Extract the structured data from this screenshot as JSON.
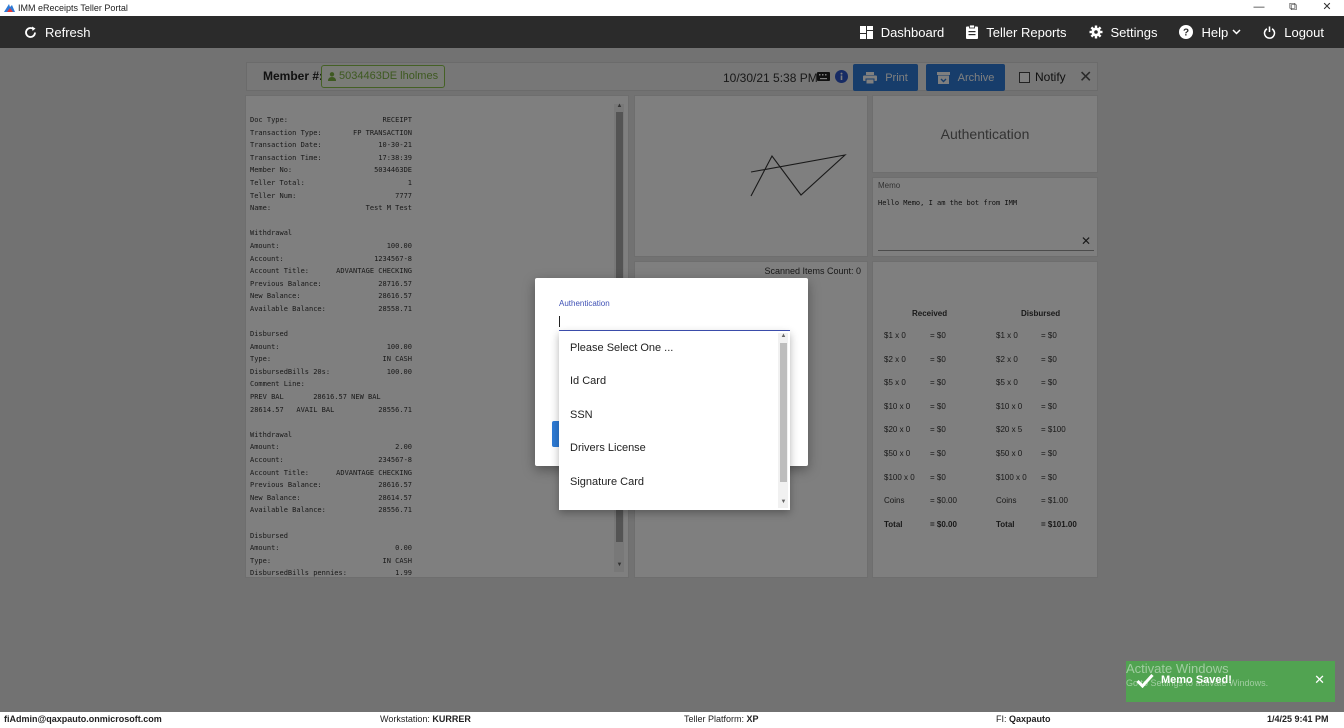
{
  "window": {
    "title": "IMM eReceipts Teller Portal",
    "controls": [
      "—",
      "⧉",
      "✕"
    ]
  },
  "nav": {
    "refresh": "Refresh",
    "dashboard": "Dashboard",
    "teller_reports": "Teller Reports",
    "settings": "Settings",
    "help": "Help",
    "logout": "Logout"
  },
  "member_bar": {
    "label": "Member #:",
    "member": "5034463DE lholmes",
    "datetime": "10/30/21 5:38 PM",
    "print": "Print",
    "archive": "Archive",
    "notify": "Notify",
    "close": "✕"
  },
  "receipt": {
    "lines": [
      [
        "Doc Type:",
        "RECEIPT"
      ],
      [
        "Transaction Type:",
        "FP TRANSACTION"
      ],
      [
        "Transaction Date:",
        "10-30-21"
      ],
      [
        "Transaction Time:",
        "17:38:39"
      ],
      [
        "Member No:",
        "5034463DE"
      ],
      [
        "Teller Total:",
        "1"
      ],
      [
        "Teller Num:",
        "7777"
      ],
      [
        "Name:",
        "Test M Test"
      ],
      [
        "",
        ""
      ],
      [
        "Withdrawal",
        ""
      ],
      [
        "Amount:",
        "100.00"
      ],
      [
        "Account:",
        "1234567-8"
      ],
      [
        "Account Title:",
        "ADVANTAGE CHECKING"
      ],
      [
        "Previous Balance:",
        "28716.57"
      ],
      [
        "New Balance:",
        "28616.57"
      ],
      [
        "Available Balance:",
        "28558.71"
      ],
      [
        "",
        ""
      ],
      [
        "Disbursed",
        ""
      ],
      [
        "Amount:",
        "100.00"
      ],
      [
        "Type:",
        "IN CASH"
      ],
      [
        "DisbursedBills 20s:",
        "100.00"
      ],
      [
        "Comment Line:",
        ""
      ],
      [
        "PREV BAL       28616.57 NEW BAL",
        ""
      ],
      [
        "28614.57   AVAIL BAL",
        "28556.71"
      ],
      [
        "",
        ""
      ],
      [
        "Withdrawal",
        ""
      ],
      [
        "Amount:",
        "2.00"
      ],
      [
        "Account:",
        "234567-8"
      ],
      [
        "Account Title:",
        "ADVANTAGE CHECKING"
      ],
      [
        "Previous Balance:",
        "28616.57"
      ],
      [
        "New Balance:",
        "28614.57"
      ],
      [
        "Available Balance:",
        "28556.71"
      ],
      [
        "",
        ""
      ],
      [
        "Disbursed",
        ""
      ],
      [
        "Amount:",
        "0.00"
      ],
      [
        "Type:",
        "IN CASH"
      ],
      [
        "DisbursedBills pennies:",
        "1.99"
      ]
    ]
  },
  "scanned_items": "Scanned Items Count: 0",
  "auth_panel_title": "Authentication",
  "memo": {
    "label": "Memo",
    "text": "Hello Memo, I am the bot from IMM",
    "clear": "✕"
  },
  "cash": {
    "received_header": "Received",
    "disbursed_header": "Disbursed",
    "rows": [
      {
        "r_denom": "$1 x 0",
        "r_amt": "= $0",
        "d_denom": "$1 x 0",
        "d_amt": "= $0"
      },
      {
        "r_denom": "$2 x 0",
        "r_amt": "= $0",
        "d_denom": "$2 x 0",
        "d_amt": "= $0"
      },
      {
        "r_denom": "$5 x 0",
        "r_amt": "= $0",
        "d_denom": "$5 x 0",
        "d_amt": "= $0"
      },
      {
        "r_denom": "$10 x 0",
        "r_amt": "= $0",
        "d_denom": "$10 x 0",
        "d_amt": "= $0"
      },
      {
        "r_denom": "$20 x 0",
        "r_amt": "= $0",
        "d_denom": "$20 x 5",
        "d_amt": "= $100"
      },
      {
        "r_denom": "$50 x 0",
        "r_amt": "= $0",
        "d_denom": "$50 x 0",
        "d_amt": "= $0"
      },
      {
        "r_denom": "$100 x 0",
        "r_amt": "= $0",
        "d_denom": "$100 x 0",
        "d_amt": "= $0"
      },
      {
        "r_denom": "Coins",
        "r_amt": "= $0.00",
        "d_denom": "Coins",
        "d_amt": "= $1.00"
      },
      {
        "r_denom": "Total",
        "r_amt": "= $0.00",
        "d_denom": "Total",
        "d_amt": "= $101.00"
      }
    ]
  },
  "dialog": {
    "label": "Authentication",
    "value": "",
    "options": [
      "Please Select One ...",
      "Id Card",
      "SSN",
      "Drivers License",
      "Signature Card"
    ]
  },
  "toast": {
    "message": "Memo Saved!",
    "close": "✕"
  },
  "watermark": {
    "title": "Activate Windows",
    "subtitle": "Go to Settings to activate Windows."
  },
  "status_bar": {
    "user": "fiAdmin@qaxpauto.onmicrosoft.com",
    "workstation_label": "Workstation:",
    "workstation": "KURRER",
    "platform_label": "Teller Platform:",
    "platform": "XP",
    "fi_label": "FI:",
    "fi": "Qaxpauto",
    "datetime": "1/4/25 9:41 PM"
  },
  "colors": {
    "nav_bg": "#2b2b2b",
    "primary": "#2e7bd6",
    "member_chip": "#7cb342",
    "toast": "#51a351",
    "focus": "#3f51b5"
  }
}
